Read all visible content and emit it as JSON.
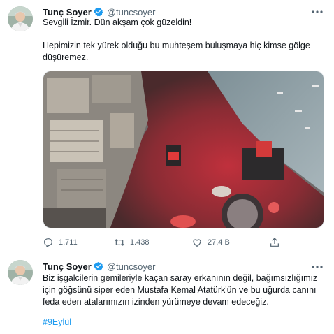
{
  "tweets": [
    {
      "author": {
        "name": "Tunç Soyer",
        "handle": "@tuncsoyer",
        "verified": true
      },
      "paragraphs": [
        "Sevgili İzmir. Dün akşam çok güzeldin!",
        "Hepimizin tek yürek olduğu bu muhteşem buluşmaya hiç kimse gölge düşüremez."
      ],
      "stats": {
        "replies": "1.711",
        "retweets": "1.438",
        "likes": "27,4 B"
      }
    },
    {
      "author": {
        "name": "Tunç Soyer",
        "handle": "@tuncsoyer",
        "verified": true
      },
      "paragraphs": [
        "Biz işgalcilerin gemileriyle kaçan saray erkanının değil, bağımsızlığımız için göğsünü siper eden Mustafa Kemal Atatürk'ün ve bu uğurda canını feda eden atalarımızın izinden yürümeye devam edeceğiz."
      ],
      "hashtag": "#9Eylül"
    }
  ],
  "colors": {
    "accent": "#1d9bf0",
    "secondary_text": "#536471",
    "crowd_red": "#d8283a"
  },
  "icons": [
    "verified-badge-icon",
    "more-icon",
    "reply-icon",
    "retweet-icon",
    "like-icon",
    "share-icon"
  ]
}
